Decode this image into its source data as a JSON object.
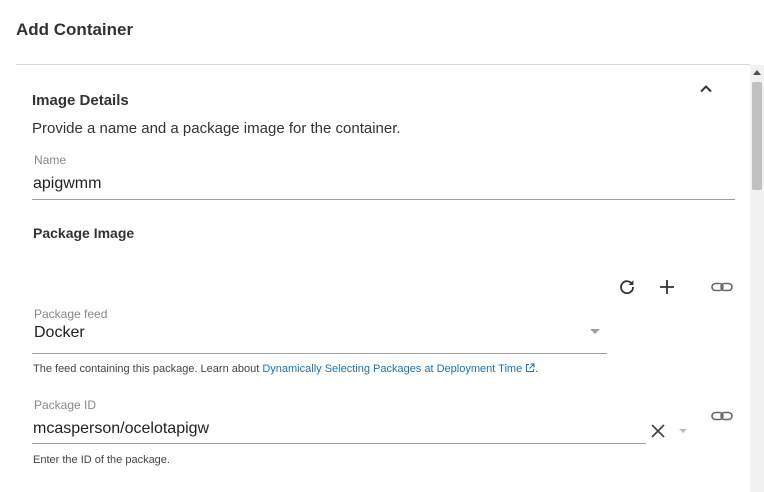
{
  "header": {
    "title": "Add Container"
  },
  "section": {
    "title": "Image Details",
    "description": "Provide a name and a package image for the container."
  },
  "name_field": {
    "label": "Name",
    "value": "apigwmm"
  },
  "package_image": {
    "heading": "Package Image"
  },
  "package_feed": {
    "label": "Package feed",
    "value": "Docker",
    "helper_prefix": "The feed containing this package. Learn about ",
    "helper_link": "Dynamically Selecting Packages at Deployment Time"
  },
  "package_id": {
    "label": "Package ID",
    "value": "mcasperson/ocelotapigw",
    "helper": "Enter the ID of the package."
  },
  "icons": {
    "collapse": "chevron-up-icon",
    "refresh": "refresh-icon",
    "add": "plus-icon",
    "link": "link-icon",
    "clear": "close-icon",
    "external": "external-link-icon"
  },
  "colors": {
    "link": "#1a73b8",
    "rule": "#cfd8dc"
  }
}
